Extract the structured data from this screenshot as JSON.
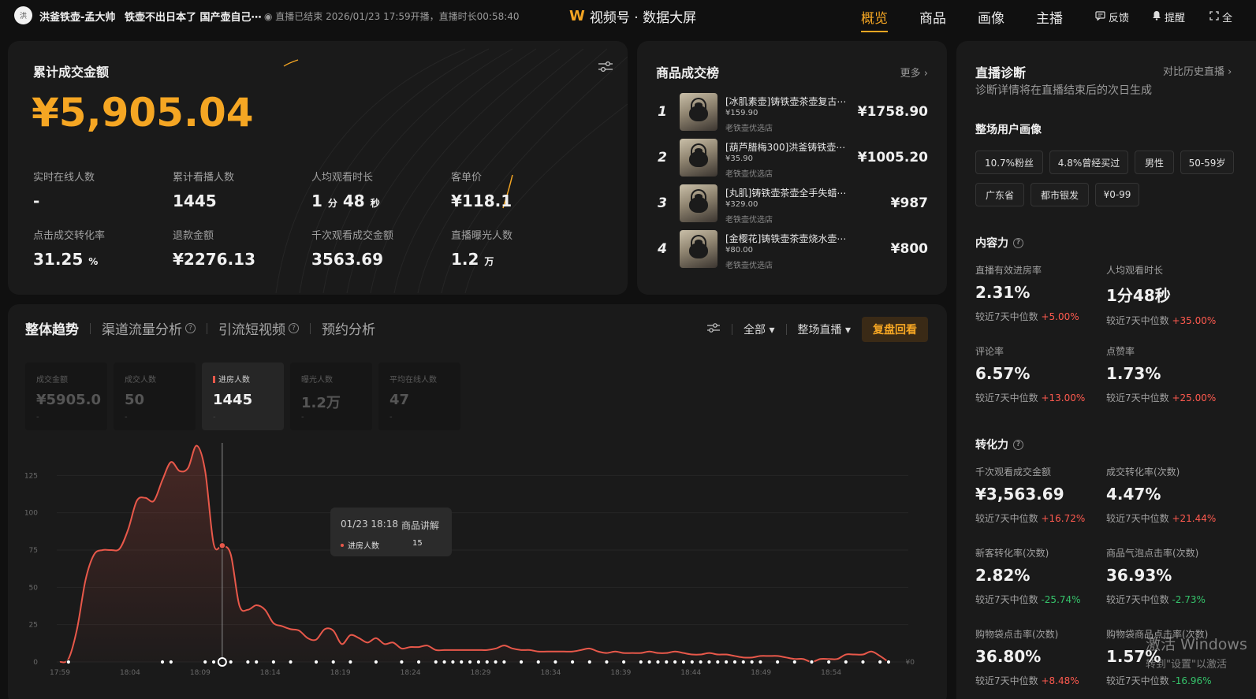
{
  "header": {
    "avatar_text": "洪",
    "shop_name": "洪釜铁壶-孟大帅",
    "live_title": "铁壶不出日本了 国产壶自己⋯",
    "live_status": "◉ 直播已结束 2026/01/23 17:59开播，直播时长00:58:40",
    "brand_name": "视频号 · 数据大屏",
    "brand_icon": "W",
    "nav": [
      "概览",
      "商品",
      "画像",
      "主播"
    ],
    "active_nav": "概览",
    "feedback": "反馈",
    "remind": "提醒",
    "fullscreen": "全"
  },
  "summary": {
    "title": "累计成交金额",
    "amount": "¥5,905.04",
    "metrics": [
      {
        "label": "实时在线人数",
        "value": "-",
        "unit": ""
      },
      {
        "label": "累计看播人数",
        "value": "1445",
        "unit": ""
      },
      {
        "label": "人均观看时长",
        "value": "1",
        "unit": "分",
        "value2": "48",
        "unit2": "秒"
      },
      {
        "label": "客单价",
        "value": "¥118.1",
        "unit": ""
      },
      {
        "label": "点击成交转化率",
        "value": "31.25",
        "unit": "%"
      },
      {
        "label": "退款金额",
        "value": "¥2276.13",
        "unit": ""
      },
      {
        "label": "千次观看成交金额",
        "value": "3563.69",
        "unit": ""
      },
      {
        "label": "直播曝光人数",
        "value": "1.2",
        "unit": "万"
      }
    ]
  },
  "ranking": {
    "title": "商品成交榜",
    "more": "更多 ›",
    "items": [
      {
        "rank": "1",
        "name": "[冰肌素壶]铸铁壶茶壶复古⋯",
        "price": "¥159.90",
        "shop": "老铁壶优选店",
        "gmv": "¥1758.90"
      },
      {
        "rank": "2",
        "name": "[葫芦腊梅300]洪釜铸铁壶⋯",
        "price": "¥35.90",
        "shop": "老铁壶优选店",
        "gmv": "¥1005.20"
      },
      {
        "rank": "3",
        "name": "[丸肌]铸铁壶茶壶全手失蜡⋯",
        "price": "¥329.00",
        "shop": "老铁壶优选店",
        "gmv": "¥987"
      },
      {
        "rank": "4",
        "name": "[金樱花]铸铁壶茶壶烧水壶⋯",
        "price": "¥80.00",
        "shop": "老铁壶优选店",
        "gmv": "¥800"
      }
    ]
  },
  "trend": {
    "tabs": [
      "整体趋势",
      "渠道流量分析",
      "引流短视频",
      "预约分析"
    ],
    "controls": {
      "scope": "全部 ▾",
      "range": "整场直播 ▾",
      "review": "复盘回看"
    },
    "metric_cards": [
      {
        "label": "成交金额",
        "value": "¥5905.0",
        "delta": "-"
      },
      {
        "label": "成交人数",
        "value": "50",
        "delta": "-"
      },
      {
        "label": "进房人数",
        "value": "1445",
        "delta": "-"
      },
      {
        "label": "曝光人数",
        "value": "1.2万",
        "delta": "-"
      },
      {
        "label": "平均在线人数",
        "value": "47",
        "delta": "-"
      }
    ],
    "tooltip": {
      "time": "01/23 18:18",
      "event": "商品讲解",
      "series": "进房人数",
      "value": "15"
    },
    "right_axis_label": "¥0"
  },
  "chart_data": {
    "type": "line",
    "series": [
      {
        "name": "进房人数",
        "color": "#e8584a",
        "values": [
          0,
          2,
          22,
          55,
          72,
          75,
          75,
          76,
          89,
          108,
          110,
          108,
          122,
          134,
          128,
          130,
          145,
          128,
          79,
          78,
          72,
          38,
          35,
          38,
          35,
          26,
          24,
          22,
          21,
          16,
          15,
          22,
          21,
          12,
          18,
          16,
          13,
          16,
          12,
          13,
          9,
          10,
          10,
          11,
          8,
          8,
          8,
          8,
          8,
          8,
          8,
          9,
          11,
          9,
          8,
          8,
          7,
          7,
          7,
          7,
          7,
          8,
          9,
          7,
          6,
          7,
          6,
          6,
          6,
          7,
          6,
          6,
          7,
          6,
          5,
          5,
          6,
          5,
          5,
          4,
          3,
          3,
          4,
          4,
          4,
          3,
          2,
          2,
          0,
          2,
          2,
          2,
          5,
          5,
          5,
          7,
          4,
          0
        ]
      }
    ],
    "x_ticks": [
      "17:59",
      "18:04",
      "18:09",
      "18:14",
      "18:19",
      "18:24",
      "18:29",
      "18:34",
      "18:39",
      "18:44",
      "18:49",
      "18:54"
    ],
    "y_ticks": [
      "0",
      "25",
      "50",
      "75",
      "100",
      "125"
    ],
    "ylim": [
      0,
      150
    ],
    "highlight_index": 19,
    "grid": true
  },
  "diagnosis": {
    "title": "直播诊断",
    "compare": "对比历史直播 ›",
    "subtitle": "诊断详情将在直播结束后的次日生成",
    "portrait_title": "整场用户画像",
    "tags": [
      "10.7%粉丝",
      "4.8%曾经买过",
      "男性",
      "50-59岁",
      "广东省",
      "都市银发",
      "¥0-99"
    ],
    "content_title": "内容力",
    "content_stats": [
      {
        "label": "直播有效进房率",
        "value": "2.31%",
        "cmp": "较近7天中位数",
        "delta": "+5.00%",
        "dir": "up"
      },
      {
        "label": "人均观看时长",
        "value": "1分48秒",
        "cmp": "较近7天中位数",
        "delta": "+35.00%",
        "dir": "up"
      },
      {
        "label": "评论率",
        "value": "6.57%",
        "cmp": "较近7天中位数",
        "delta": "+13.00%",
        "dir": "up"
      },
      {
        "label": "点赞率",
        "value": "1.73%",
        "cmp": "较近7天中位数",
        "delta": "+25.00%",
        "dir": "up"
      }
    ],
    "conversion_title": "转化力",
    "conversion_stats": [
      {
        "label": "千次观看成交金额",
        "value": "¥3,563.69",
        "cmp": "较近7天中位数",
        "delta": "+16.72%",
        "dir": "up"
      },
      {
        "label": "成交转化率(次数)",
        "value": "4.47%",
        "cmp": "较近7天中位数",
        "delta": "+21.44%",
        "dir": "up"
      },
      {
        "label": "新客转化率(次数)",
        "value": "2.82%",
        "cmp": "较近7天中位数",
        "delta": "-25.74%",
        "dir": "down"
      },
      {
        "label": "商品气泡点击率(次数)",
        "value": "36.93%",
        "cmp": "较近7天中位数",
        "delta": "-2.73%",
        "dir": "down"
      },
      {
        "label": "购物袋点击率(次数)",
        "value": "36.80%",
        "cmp": "较近7天中位数",
        "delta": "+8.48%",
        "dir": "up"
      },
      {
        "label": "购物袋商品点击率(次数)",
        "value": "1.57%",
        "cmp": "较近7天中位数",
        "delta": "-16.96%",
        "dir": "down"
      }
    ]
  },
  "watermark": {
    "line1": "激活 Windows",
    "line2": "转到\"设置\"以激活"
  },
  "colors": {
    "accent": "#f5a623",
    "line": "#e8584a",
    "up": "#ff5a4f",
    "down": "#35c26a"
  }
}
